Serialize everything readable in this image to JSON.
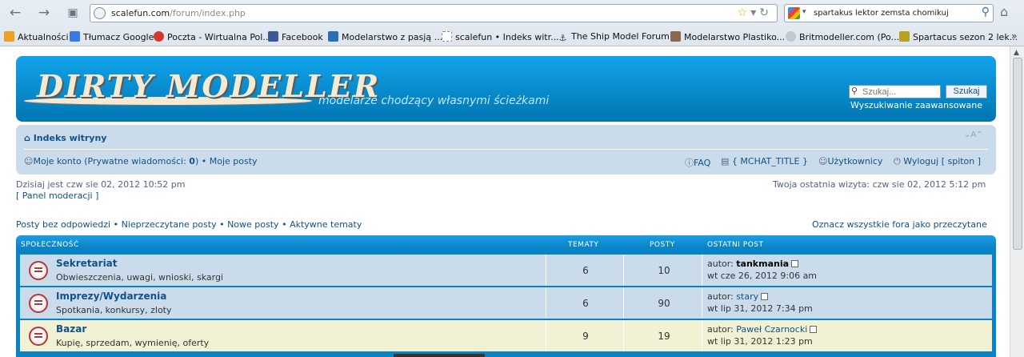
{
  "browser": {
    "url_host": "scalefun.com",
    "url_path": "/forum/index.php",
    "search_value": "spartakus lektor zemsta chomikuj",
    "bookmarks": [
      {
        "label": "Aktualności",
        "color": "#f0a020"
      },
      {
        "label": "Tłumacz Google",
        "color": "#3b78e7"
      },
      {
        "label": "Poczta - Wirtualna Pol...",
        "color": "#d33a2c"
      },
      {
        "label": "Facebook",
        "color": "#3b5998"
      },
      {
        "label": "Modelarstwo z pasją ...",
        "color": "#2c6fb0"
      },
      {
        "label": "scalefun • Indeks witr...",
        "color": "#ffffff"
      },
      {
        "label": "The Ship Model Forum...",
        "color": "#1a3c8a"
      },
      {
        "label": "Modelarstwo Plastiko...",
        "color": "#8a6a4a"
      },
      {
        "label": "Britmodeller.com (Po...",
        "color": "#c0c8d0"
      },
      {
        "label": "Spartacus sezon 2 lek...",
        "color": "#b8a020"
      }
    ]
  },
  "header": {
    "logo_text": "DIRTY MODELLER",
    "tagline": "modelarze chodzący własnymi ścieżkami",
    "search_placeholder": "Szukaj...",
    "search_button": "Szukaj",
    "advanced_search": "Wyszukiwanie zaawansowane"
  },
  "navbar": {
    "breadcrumb": "Indeks witryny",
    "font_size_control": "A",
    "my_account": "Moje konto",
    "pm_prefix": "(Prywatne wiadomości: ",
    "pm_count": "0",
    "pm_suffix": ")",
    "my_posts": "Moje posty",
    "faq": "FAQ",
    "mchat": "{ MCHAT_TITLE }",
    "users": "Użytkownicy",
    "logout": "Wyloguj [ spiton ]"
  },
  "info": {
    "current_time": "Dzisiaj jest czw sie 02, 2012 10:52 pm",
    "mod_panel": "[ Panel moderacji ]",
    "last_visit": "Twoja ostatnia wizyta: czw sie 02, 2012 5:12 pm",
    "quick_links": [
      "Posty bez odpowiedzi",
      "Nieprzeczytane posty",
      "Nowe posty",
      "Aktywne tematy"
    ],
    "mark_read": "Oznacz wszystkie fora jako przeczytane"
  },
  "forum": {
    "category": "SPOŁECZNOŚĆ",
    "col_topics": "TEMATY",
    "col_posts": "POSTY",
    "col_last": "OSTATNI POST",
    "rows": [
      {
        "title": "Sekretariat",
        "desc": "Obwieszczenia, uwagi, wnioski, skargi",
        "topics": "6",
        "posts": "10",
        "author_label": "autor:",
        "author": "tankmania",
        "date": "wt cze 26, 2012 9:06 am",
        "bg": "#cadceb"
      },
      {
        "title": "Imprezy/Wydarzenia",
        "desc": "Spotkania, konkursy, zloty",
        "topics": "6",
        "posts": "90",
        "author_label": "autor:",
        "author": "stary",
        "date": "wt lip 31, 2012 7:34 pm",
        "bg": "#cadceb"
      },
      {
        "title": "Bazar",
        "desc": "Kupię, sprzedam, wymienię, oferty",
        "topics": "9",
        "posts": "19",
        "author_label": "autor:",
        "author": "Paweł Czarnocki",
        "date": "wt lip 31, 2012 1:23 pm",
        "bg": "#f3f1d3"
      }
    ]
  }
}
